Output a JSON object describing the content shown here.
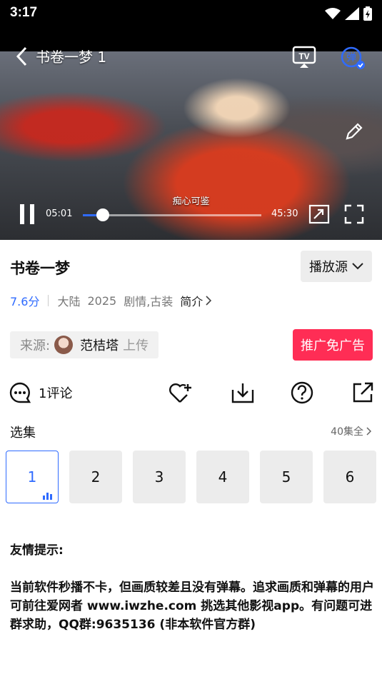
{
  "status_bar": {
    "time": "3:17"
  },
  "video": {
    "title": "书卷一梦 1",
    "subtitle": "痴心可鉴",
    "current_time": "05:01",
    "total_time": "45:30",
    "progress": 0.11
  },
  "info": {
    "show_title": "书卷一梦",
    "source_button": "播放源",
    "rating": "7.6分",
    "region": "大陆",
    "year": "2025",
    "genres": "剧情,古装",
    "intro_link": "简介"
  },
  "uploader": {
    "label": "来源:",
    "name": "范桔塔",
    "suffix": "上传"
  },
  "ad_button": "推广免广告",
  "actions": {
    "comments": "1评论"
  },
  "episodes": {
    "title": "选集",
    "all_label": "40集全",
    "items": [
      "1",
      "2",
      "3",
      "4",
      "5",
      "6"
    ],
    "active_index": 0
  },
  "notice": {
    "heading": "友情提示:",
    "body": "当前软件秒播不卡，但画质较差且没有弹幕。追求画质和弹幕的用户可前往爱网者 www.iwzhe.com 挑选其他影视app。有问题可进群求助，QQ群:9635136 (非本软件官方群)"
  },
  "colors": {
    "accent": "#2f6bff",
    "ad": "#ff2d55"
  }
}
